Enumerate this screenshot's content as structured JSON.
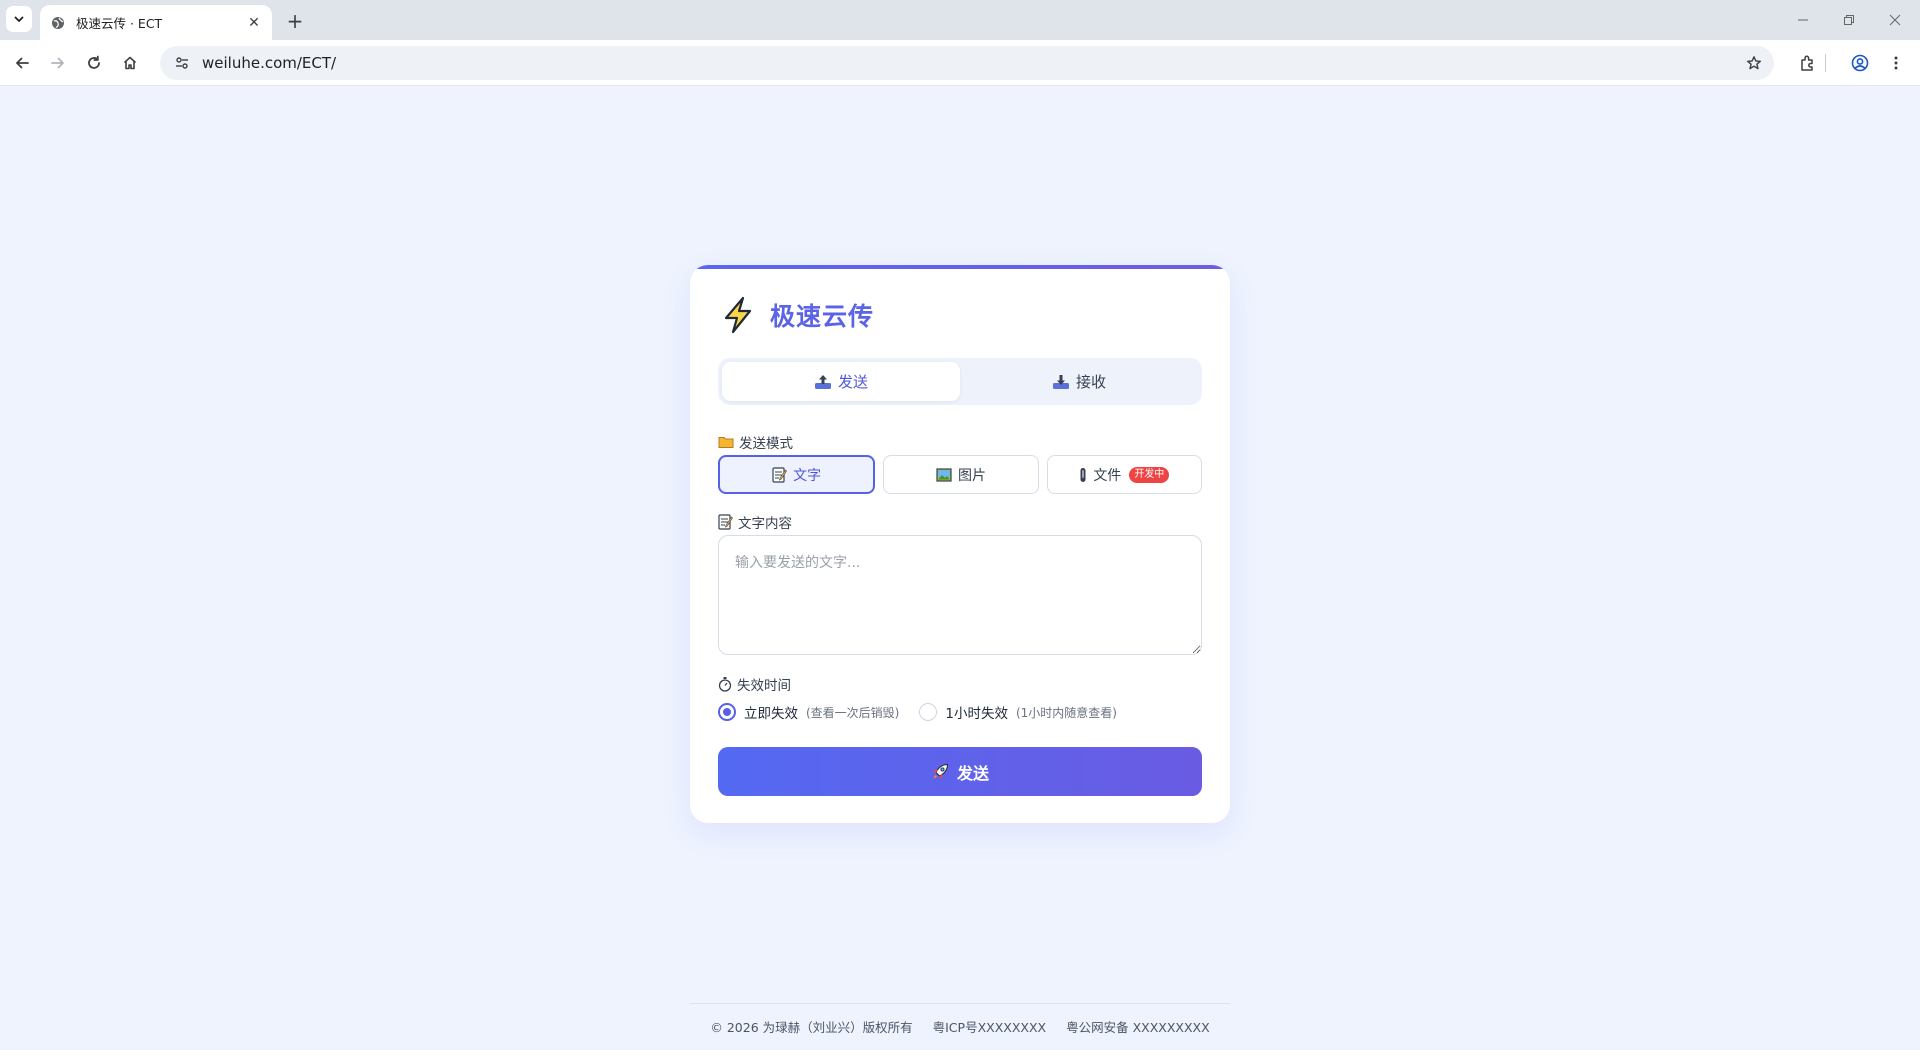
{
  "browser": {
    "tab_title": "极速云传 · ECT",
    "tab_close": "✕",
    "new_tab": "+",
    "url": "weiluhe.com/ECT/"
  },
  "app": {
    "title": "极速云传",
    "accent_color": "#5b63e6",
    "tabs": [
      {
        "label": "发送",
        "icon": "upload-tray-icon",
        "active": true
      },
      {
        "label": "接收",
        "icon": "download-tray-icon",
        "active": false
      }
    ],
    "send_mode": {
      "label": "发送模式",
      "icon": "folder-icon",
      "options": [
        {
          "label": "文字",
          "icon": "memo-icon",
          "active": true
        },
        {
          "label": "图片",
          "icon": "picture-icon",
          "active": false
        },
        {
          "label": "文件",
          "icon": "file-icon",
          "active": false,
          "badge": "开发中"
        }
      ]
    },
    "text_content": {
      "label": "文字内容",
      "icon": "memo-icon",
      "placeholder": "输入要发送的文字..."
    },
    "expiry": {
      "label": "失效时间",
      "icon": "stopwatch-icon",
      "options": [
        {
          "label": "立即失效",
          "hint": "(查看一次后销毁)",
          "checked": true
        },
        {
          "label": "1小时失效",
          "hint": "(1小时内随意查看)",
          "checked": false
        }
      ]
    },
    "send_button": {
      "label": "发送",
      "icon": "rocket-icon"
    }
  },
  "footer": {
    "copyright": "© 2026 为琭赫（刘业兴）版权所有",
    "icp": "粤ICP号XXXXXXXX",
    "police": "粤公网安备 XXXXXXXXX"
  }
}
